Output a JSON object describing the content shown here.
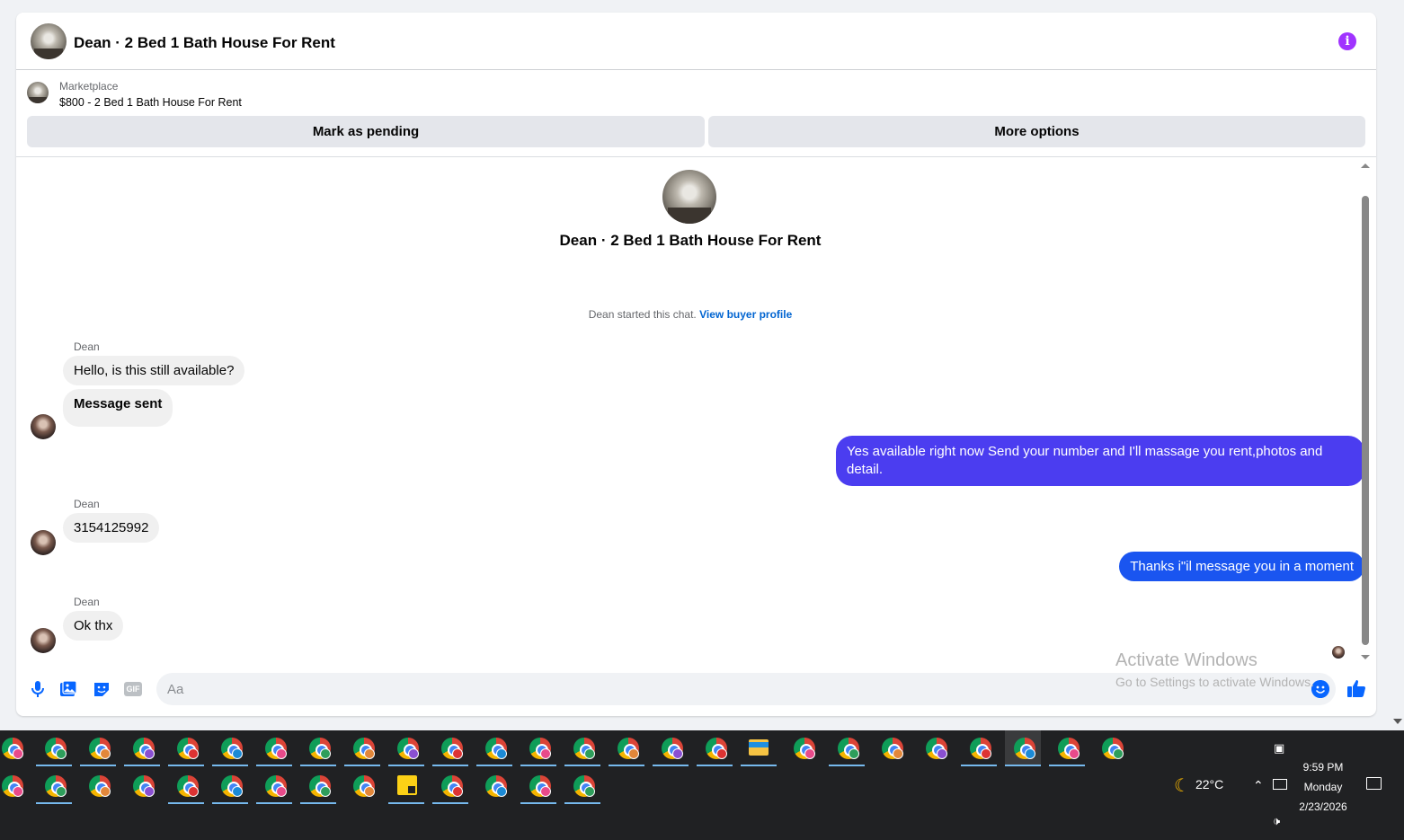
{
  "header": {
    "title": "Dean · 2 Bed 1 Bath House For Rent",
    "info_icon": "info-icon"
  },
  "listing": {
    "source": "Marketplace",
    "price_title": "$800 - 2 Bed 1 Bath House For Rent",
    "mark_pending_label": "Mark as pending",
    "more_options_label": "More options"
  },
  "thread": {
    "title": "Dean · 2 Bed 1 Bath House For Rent",
    "started_text": "Dean started this chat.",
    "view_profile_label": "View buyer profile",
    "messages": [
      {
        "sender": "Dean",
        "text": "Hello, is this still available?"
      },
      {
        "text": "Message sent"
      },
      {
        "text": "Yes available right now Send your number and I'll massage you rent,photos and detail."
      },
      {
        "sender": "Dean",
        "text": "3154125992"
      },
      {
        "text": "Thanks i\"il message you in a moment"
      },
      {
        "sender": "Dean",
        "text": "Ok thx"
      }
    ]
  },
  "watermark": {
    "line1": "Activate Windows",
    "line2": "Go to Settings to activate Windows."
  },
  "composer": {
    "placeholder": "Aa",
    "icons": [
      "microphone-icon",
      "photo-icon",
      "sticker-icon",
      "gif-icon",
      "emoji-icon",
      "like-icon"
    ],
    "gif_label": "GIF"
  },
  "colors": {
    "outgoing_1": "#4b3df0",
    "outgoing_2": "#1a55f0",
    "accent": "#0866ff",
    "info": "#a033ff"
  },
  "taskbar": {
    "weather": "22°C",
    "time": "9:59 PM",
    "day": "Monday",
    "date": "2/23/2026"
  }
}
